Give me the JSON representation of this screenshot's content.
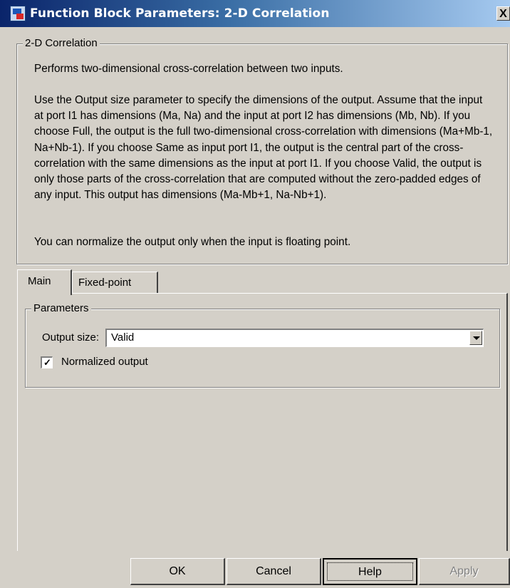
{
  "window": {
    "title": "Function Block Parameters: 2-D Correlation",
    "close_label": "X"
  },
  "description": {
    "group_title": "2-D Correlation",
    "paragraphs": [
      "Performs two-dimensional cross-correlation between two inputs.",
      "Use the Output size parameter to specify the dimensions of the output. Assume that the input at port I1 has dimensions (Ma, Na) and the input at port I2 has dimensions (Mb, Nb). If you choose Full, the output is the full two-dimensional cross-correlation with dimensions (Ma+Mb-1, Na+Nb-1). If you choose Same as input port I1, the output is the central part of the cross-correlation with the same dimensions as the input at port I1. If you choose Valid, the output is only those parts of the cross-correlation that are computed without the zero-padded edges of any input. This output has dimensions (Ma-Mb+1, Na-Nb+1).",
      "You can normalize the output only when the input is floating point."
    ]
  },
  "tabs": [
    {
      "label": "Main",
      "active": true
    },
    {
      "label": "Fixed-point",
      "active": false
    }
  ],
  "parameters": {
    "group_title": "Parameters",
    "output_size_label": "Output size:",
    "output_size_value": "Valid",
    "normalized_label": "Normalized output",
    "normalized_checked": true
  },
  "buttons": {
    "ok": "OK",
    "cancel": "Cancel",
    "help": "Help",
    "apply": "Apply"
  }
}
